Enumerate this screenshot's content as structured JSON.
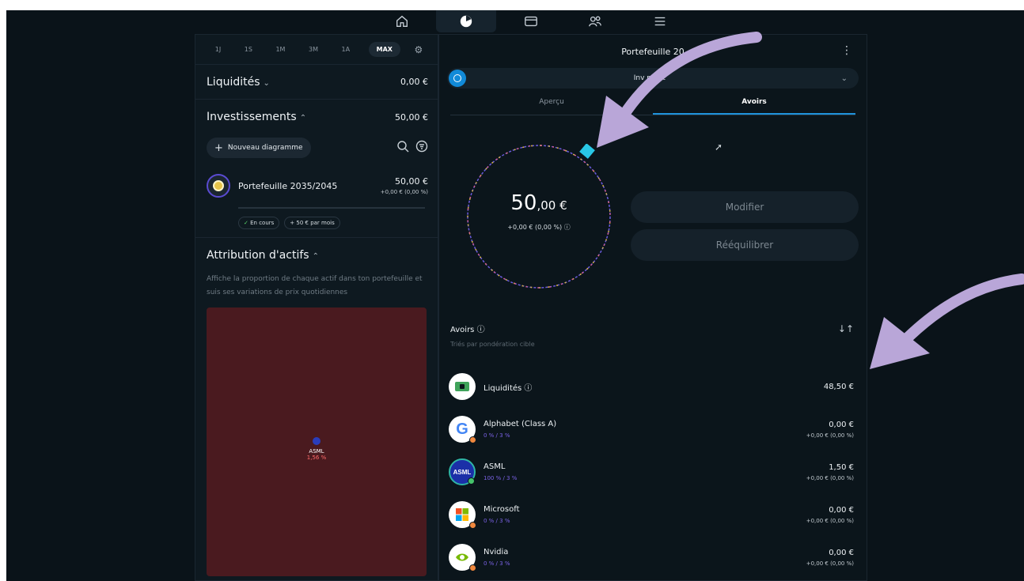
{
  "nav": {
    "items": [
      {
        "id": "home",
        "icon": "home-icon"
      },
      {
        "id": "portfolio",
        "icon": "pie-chart-icon",
        "active": true
      },
      {
        "id": "cards",
        "icon": "card-icon"
      },
      {
        "id": "community",
        "icon": "people-icon"
      },
      {
        "id": "menu",
        "icon": "menu-icon"
      }
    ]
  },
  "left": {
    "timeframes": [
      "1J",
      "1S",
      "1M",
      "3M",
      "1A",
      "MAX"
    ],
    "timeframe_active": "MAX",
    "liquidites": {
      "label": "Liquidités",
      "value": "0,00 €"
    },
    "investissements": {
      "label": "Investissements",
      "value": "50,00 €"
    },
    "new_diagram": "Nouveau diagramme",
    "portfolio": {
      "name": "Portefeuille 2035/2045",
      "value": "50,00 €",
      "delta": "+0,00 € (0,00 %)",
      "tag_status": "En cours",
      "tag_plan": "+ 50 € par mois"
    },
    "attribution": {
      "title": "Attribution d'actifs",
      "description": "Affiche la proportion de chaque actif dans ton portefeuille et suis ses variations de prix quotidiennes",
      "treemap_name": "ASML",
      "treemap_pct": "1,56 %"
    }
  },
  "right": {
    "title": "Portefeuille 20",
    "dropdown": "Inv          ment",
    "tabs": [
      {
        "label": "Aperçu"
      },
      {
        "label": "Avoirs",
        "active": true
      }
    ],
    "total_main": "50",
    "total_cents": ",00 €",
    "total_delta": "+0,00 € (0,00 %) ⓘ",
    "modify": "Modifier",
    "rebalance": "Rééquilibrer",
    "holdings_title": "Avoirs ⓘ",
    "holdings_sub": "Triés par pondération cible",
    "holdings": [
      {
        "name": "Liquidités ⓘ",
        "weight": "",
        "value": "48,50 €",
        "delta": "",
        "logo": "cash-icon",
        "dot": ""
      },
      {
        "name": "Alphabet (Class A)",
        "weight": "0 % / 3 %",
        "value": "0,00 €",
        "delta": "+0,00 € (0,00 %)",
        "logo": "google-icon",
        "dot": "#f0883e"
      },
      {
        "name": "ASML",
        "weight": "100 % / 3 %",
        "value": "1,50 €",
        "delta": "+0,00 € (0,00 %)",
        "logo": "asml-icon",
        "dot": "#45c36b"
      },
      {
        "name": "Microsoft",
        "weight": "0 % / 3 %",
        "value": "0,00 €",
        "delta": "+0,00 € (0,00 %)",
        "logo": "microsoft-icon",
        "dot": "#f0883e"
      },
      {
        "name": "Nvidia",
        "weight": "0 % / 3 %",
        "value": "0,00 €",
        "delta": "+0,00 € (0,00 %)",
        "logo": "nvidia-icon",
        "dot": "#f0883e"
      }
    ]
  },
  "colors": {
    "background": "#0a1319",
    "accent": "#1f93dc",
    "arrow": "#b9a6d8",
    "treemap": "#4a1a1f"
  }
}
